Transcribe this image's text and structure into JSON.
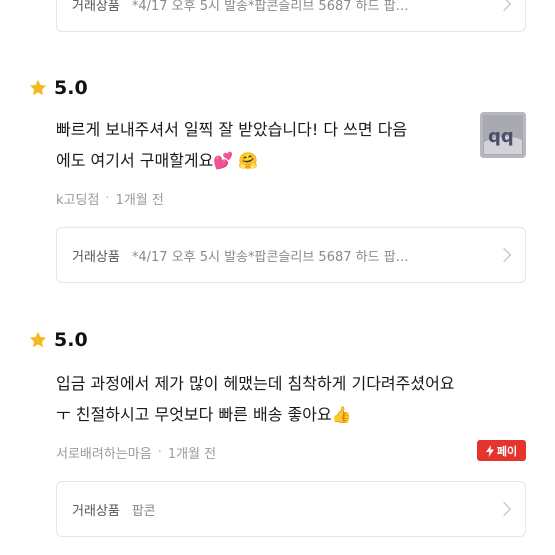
{
  "reviews": [
    {
      "product_label": "거래상품",
      "product_name": "*4/17 오후 5시 발송*팝콘슬리브 5687 하드 팝…"
    },
    {
      "score": "5.0",
      "line1": "빠르게 보내주셔서 일찍 잘 받았습니다! 다 쓰면 다음",
      "line2": "에도 여기서 구매할게요",
      "reviewer": "k고딩점",
      "time": "1개월 전",
      "product_label": "거래상품",
      "product_name": "*4/17 오후 5시 발송*팝콘슬리브 5687 하드 팝…"
    },
    {
      "score": "5.0",
      "line1": "입금 과정에서 제가 많이 헤맸는데 침착하게 기다려주셨어요",
      "line2": "ㅜ 친절하시고 무엇보다 빠른 배송 좋아요",
      "reviewer": "서로배려하는마음",
      "time": "1개월 전",
      "badge": "페이",
      "product_label": "거래상품",
      "product_name": "팝콘"
    }
  ],
  "colors": {
    "star": "#F5B820",
    "pay_badge": "#E5342E"
  }
}
